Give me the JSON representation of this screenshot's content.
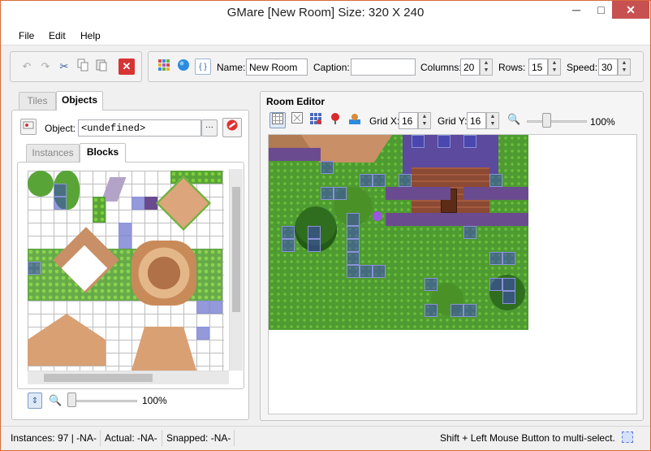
{
  "window": {
    "title": "GMare [New Room] Size: 320 X 240",
    "minimize": "─",
    "maximize": "□",
    "close": "✕"
  },
  "menu": [
    "File",
    "Edit",
    "Help"
  ],
  "toolbar": {
    "name_label": "Name:",
    "name_value": "New Room",
    "caption_label": "Caption:",
    "caption_value": "",
    "columns_label": "Columns:",
    "columns_value": "20",
    "rows_label": "Rows:",
    "rows_value": "15",
    "speed_label": "Speed:",
    "speed_value": "30"
  },
  "left_panel": {
    "tabs": [
      "Tiles",
      "Objects"
    ],
    "active_tab": "Objects",
    "object_label": "Object:",
    "object_value": "<undefined>",
    "browse_label": "···",
    "sub_tabs": [
      "Instances",
      "Blocks"
    ],
    "active_sub_tab": "Blocks",
    "zoom_text": "100%",
    "zoom_level": 0
  },
  "room_editor": {
    "title": "Room Editor",
    "grid_x_label": "Grid X:",
    "grid_x_value": "16",
    "grid_y_label": "Grid Y:",
    "grid_y_value": "16",
    "zoom_text": "100%",
    "zoom_level": 0.3
  },
  "status": {
    "instances": "Instances: 97 | -NA-",
    "actual": "Actual: -NA-",
    "snapped": "Snapped: -NA-",
    "hint": "Shift + Left Mouse Button to multi-select."
  },
  "icons": {
    "undo": "undo-icon",
    "redo": "redo-icon",
    "cut": "cut-icon",
    "copy": "copy-icon",
    "paste": "paste-icon",
    "delete": "delete-icon",
    "room_grid": "grid-icon",
    "background": "background-color-icon",
    "code": "code-icon"
  },
  "colors": {
    "accent_close": "#c75050",
    "grass": "#58a437",
    "selection": "#3c46be"
  }
}
